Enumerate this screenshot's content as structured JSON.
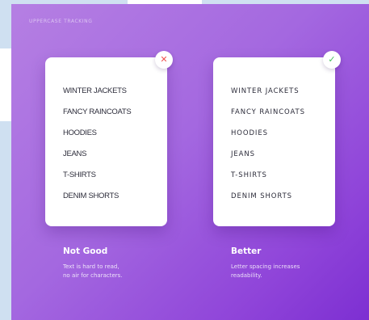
{
  "section_label": "UPPERCASE TRACKING",
  "colors": {
    "gradient_start": "#b57fe3",
    "gradient_end": "#7d2fd2",
    "bad_badge": "#f0524f",
    "good_badge": "#46c15d"
  },
  "bad_example": {
    "icon": "x-icon",
    "badge_glyph": "✕",
    "items": [
      "WINTER JACKETS",
      "FANCY RAINCOATS",
      "HOODIES",
      "JEANS",
      "T-SHIRTS",
      "DENIM SHORTS"
    ],
    "title": "Not Good",
    "description_line1": "Text is hard to read,",
    "description_line2": "no air for characters."
  },
  "good_example": {
    "icon": "check-icon",
    "badge_glyph": "✓",
    "items": [
      "WINTER JACKETS",
      "FANCY RAINCOATS",
      "HOODIES",
      "JEANS",
      "T-SHIRTS",
      "DENIM SHORTS"
    ],
    "title": "Better",
    "description_line1": "Letter spacing increases",
    "description_line2": "readability."
  }
}
